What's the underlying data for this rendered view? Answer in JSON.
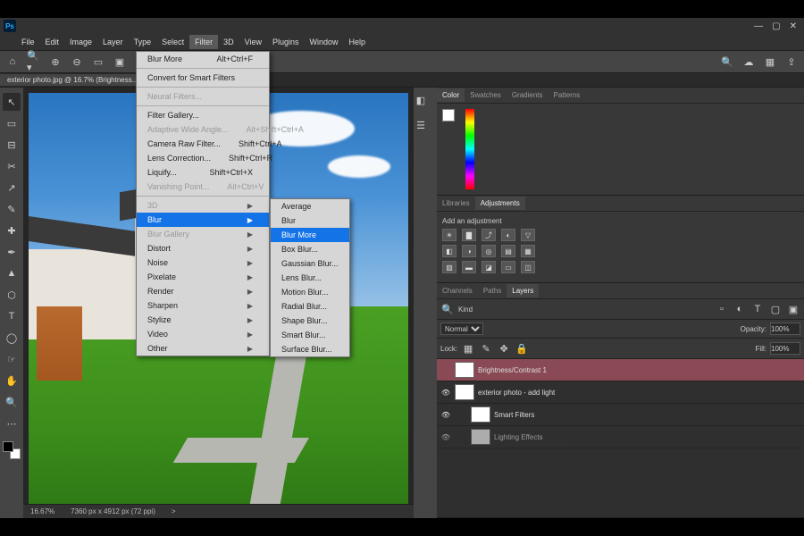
{
  "window": {
    "minimize": "—",
    "maximize": "▢",
    "close": "✕"
  },
  "menubar": [
    "File",
    "Edit",
    "Image",
    "Layer",
    "Type",
    "Select",
    "Filter",
    "3D",
    "View",
    "Plugins",
    "Window",
    "Help"
  ],
  "menubar_open_index": 6,
  "doctab": "exterior photo.jpg @ 16.7% (Brightness...",
  "statusbar": {
    "zoom": "16.67%",
    "docinfo": "7360 px x 4912 px (72 ppi)",
    "chevron": ">"
  },
  "filter_menu": {
    "top": [
      {
        "label": "Blur More",
        "shortcut": "Alt+Ctrl+F"
      }
    ],
    "groups": [
      [
        {
          "label": "Convert for Smart Filters"
        }
      ],
      [
        {
          "label": "Neural Filters...",
          "dis": true
        }
      ],
      [
        {
          "label": "Filter Gallery..."
        },
        {
          "label": "Adaptive Wide Angle...",
          "shortcut": "Alt+Shift+Ctrl+A",
          "dis": true
        },
        {
          "label": "Camera Raw Filter...",
          "shortcut": "Shift+Ctrl+A"
        },
        {
          "label": "Lens Correction...",
          "shortcut": "Shift+Ctrl+R"
        },
        {
          "label": "Liquify...",
          "shortcut": "Shift+Ctrl+X"
        },
        {
          "label": "Vanishing Point...",
          "shortcut": "Alt+Ctrl+V",
          "dis": true
        }
      ],
      [
        {
          "label": "3D",
          "sub": true,
          "dis": true
        },
        {
          "label": "Blur",
          "sub": true,
          "hl": true
        },
        {
          "label": "Blur Gallery",
          "sub": true,
          "dis": true
        },
        {
          "label": "Distort",
          "sub": true
        },
        {
          "label": "Noise",
          "sub": true
        },
        {
          "label": "Pixelate",
          "sub": true
        },
        {
          "label": "Render",
          "sub": true
        },
        {
          "label": "Sharpen",
          "sub": true
        },
        {
          "label": "Stylize",
          "sub": true
        },
        {
          "label": "Video",
          "sub": true
        },
        {
          "label": "Other",
          "sub": true
        }
      ]
    ]
  },
  "blur_submenu": [
    {
      "label": "Average"
    },
    {
      "label": "Blur"
    },
    {
      "label": "Blur More",
      "hl": true
    },
    {
      "label": "Box Blur..."
    },
    {
      "label": "Gaussian Blur..."
    },
    {
      "label": "Lens Blur..."
    },
    {
      "label": "Motion Blur..."
    },
    {
      "label": "Radial Blur..."
    },
    {
      "label": "Shape Blur..."
    },
    {
      "label": "Smart Blur..."
    },
    {
      "label": "Surface Blur..."
    }
  ],
  "panels": {
    "color": {
      "tabs": [
        "Color",
        "Swatches",
        "Gradients",
        "Patterns"
      ],
      "active": 0
    },
    "adjust": {
      "tabs": [
        "Libraries",
        "Adjustments"
      ],
      "active": 1,
      "hint": "Add an adjustment"
    },
    "layers": {
      "tabs": [
        "Channels",
        "Paths",
        "Layers"
      ],
      "active": 2,
      "kind_label": "Kind",
      "blend": "Normal",
      "opacity_label": "Opacity:",
      "opacity_val": "100%",
      "lock_label": "Lock:",
      "fill_label": "Fill:",
      "fill_val": "100%",
      "items": [
        {
          "name": "Brightness/Contrast 1",
          "sel": true,
          "eye": ""
        },
        {
          "name": "exterior photo - add light",
          "eye": "👁"
        },
        {
          "name": "Smart Filters",
          "indent": true,
          "eye": "👁"
        },
        {
          "name": "Lighting Effects",
          "indent": true,
          "eye": "👁",
          "dim": true
        }
      ]
    }
  },
  "tools": [
    "↖",
    "▭",
    "⊟",
    "✂",
    "↗",
    "✎",
    "✚",
    "✒",
    "▲",
    "⬡",
    "T",
    "◯",
    "☞",
    "✋",
    "🔍",
    "⋯"
  ]
}
